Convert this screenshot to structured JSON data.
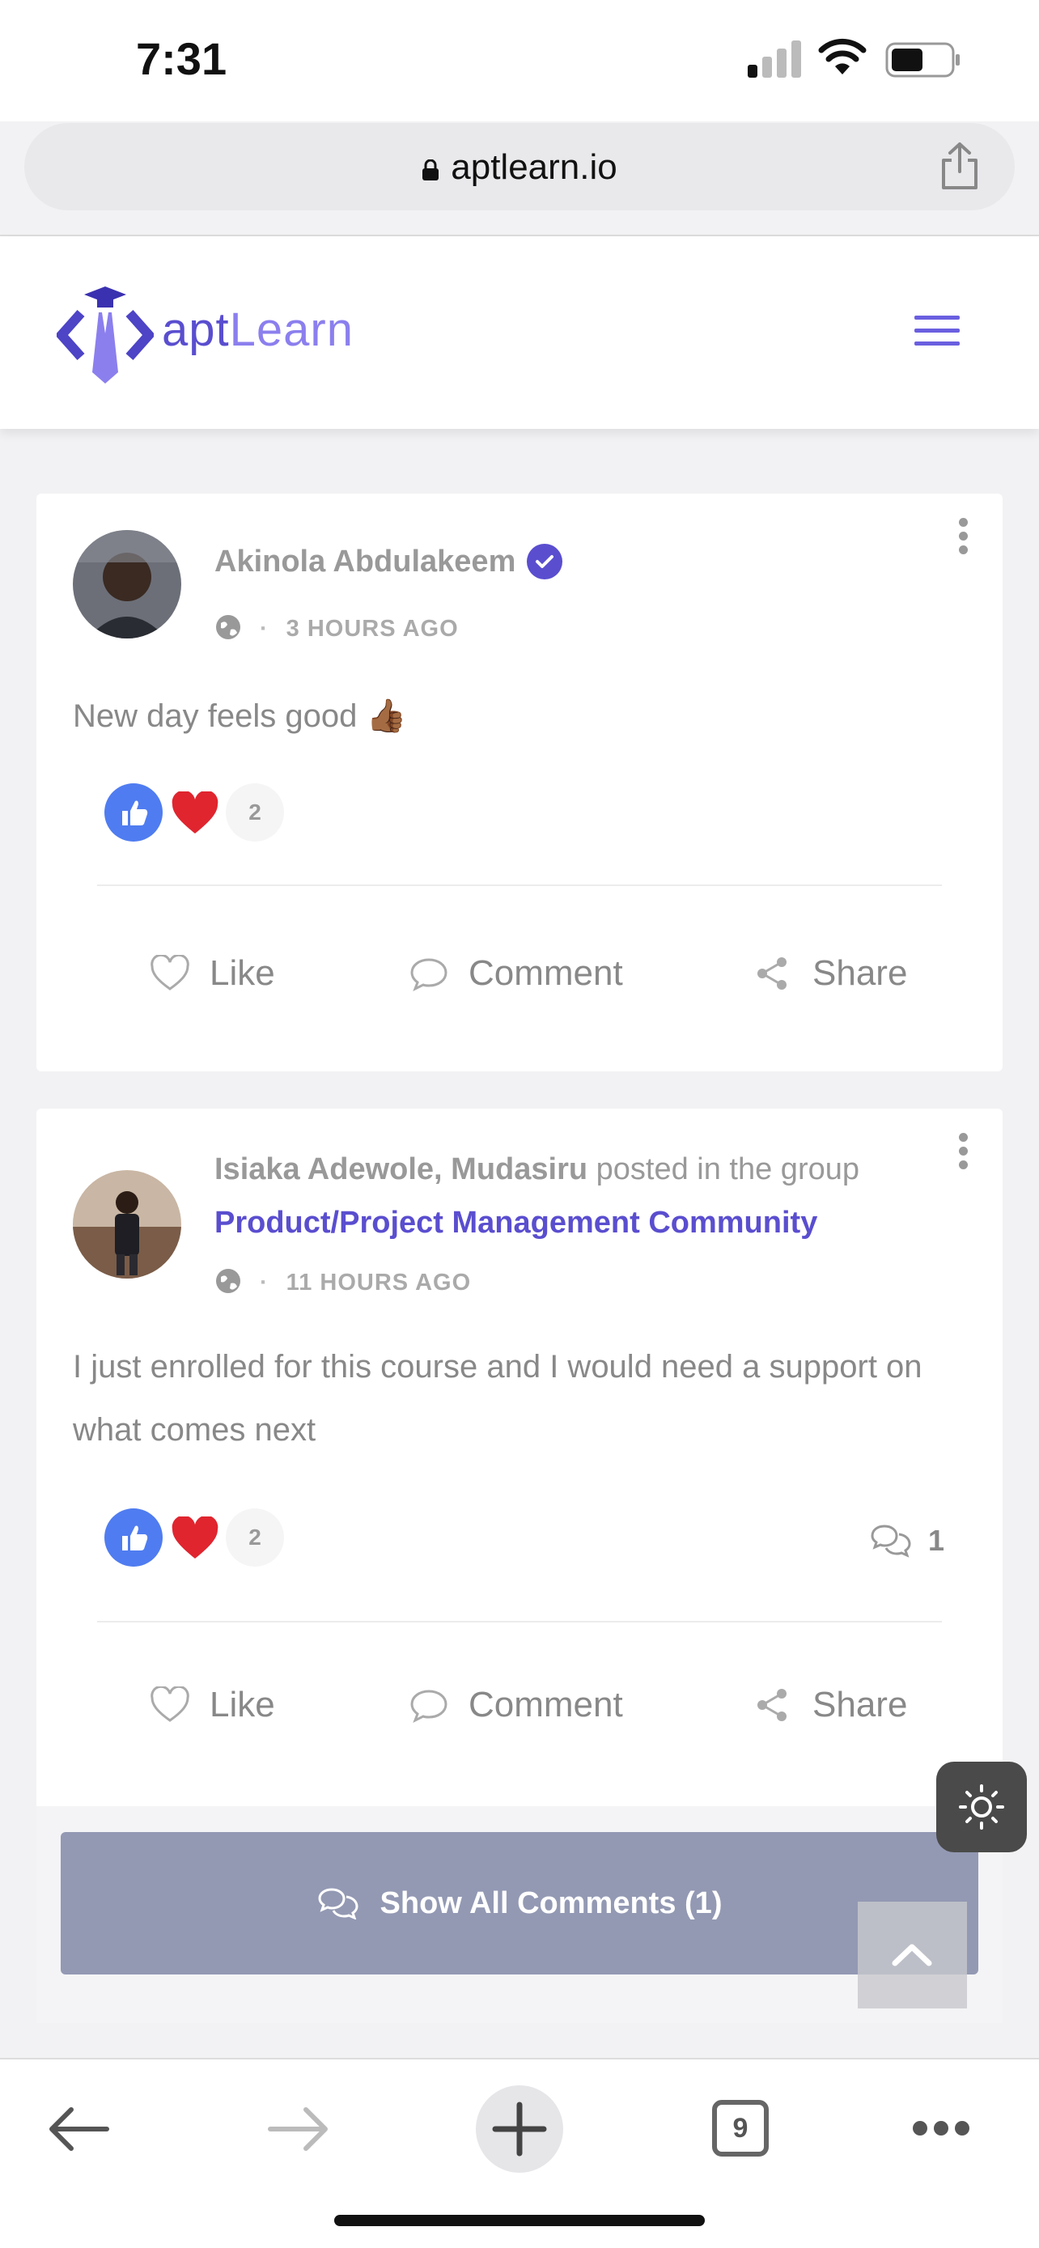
{
  "status_bar": {
    "time": "7:31"
  },
  "browser": {
    "url": "aptlearn.io",
    "tab_count": "9"
  },
  "site": {
    "logo_part1": "apt",
    "logo_part2": "Learn"
  },
  "posts": [
    {
      "author": "Akinola Abdulakeem",
      "time": "3 HOURS AGO",
      "text": "New day feels good 👍🏾",
      "reaction_count": "2",
      "actions": {
        "like": "Like",
        "comment": "Comment",
        "share": "Share"
      }
    },
    {
      "author": "Isiaka Adewole, Mudasiru",
      "posted_in": "posted in the group",
      "group": "Product/Project Management Community",
      "time": "11 HOURS AGO",
      "text": "I just enrolled for this course and I would need a support on what comes next",
      "reaction_count": "2",
      "comment_count": "1",
      "actions": {
        "like": "Like",
        "comment": "Comment",
        "share": "Share"
      },
      "show_all_comments": "Show All Comments (1)"
    }
  ],
  "colors": {
    "brand": "#5a4ecf",
    "like_blue": "#4f7cf0",
    "heart_red": "#e0252f",
    "show_all_bg": "#9399b3"
  }
}
